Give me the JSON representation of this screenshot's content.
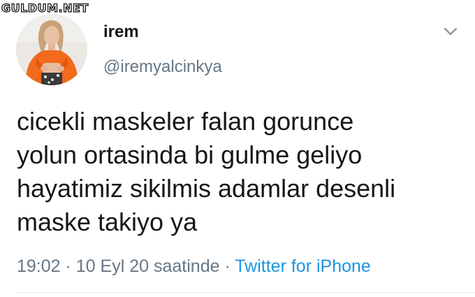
{
  "watermark": "GULDUM.NET",
  "user": {
    "display_name": "irem",
    "handle": "@iremyalcinkya"
  },
  "tweet": {
    "lines": [
      "cicekli maskeler falan gorunce",
      "yolun ortasinda bi gulme geliyo",
      "hayatimiz sikilmis adamlar desenli",
      "maske takiyo ya"
    ],
    "time": "19:02",
    "separator": "·",
    "date": "10 Eyl 20 saatinde",
    "source": "Twitter for iPhone"
  },
  "icons": {
    "caret": "chevron-down-icon",
    "avatar": "profile-photo"
  },
  "colors": {
    "text": "#14171a",
    "secondary": "#657786",
    "link": "#1b95e0",
    "divider": "#e1e8ed",
    "avatar_shirt": "#f26a1b"
  }
}
